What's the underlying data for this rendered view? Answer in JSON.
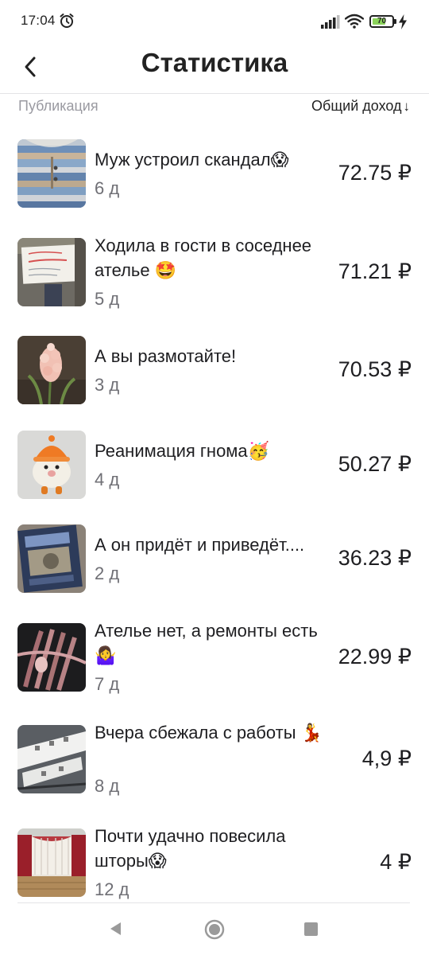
{
  "status_bar": {
    "time": "17:04",
    "battery_level": "70",
    "battery_fraction": 0.7,
    "icons": [
      "alarm-icon",
      "signal-icon",
      "wifi-icon",
      "battery-icon",
      "charging-bolt-icon"
    ]
  },
  "header": {
    "title": "Статистика",
    "back_icon": "chevron-left-icon"
  },
  "columns": {
    "publication": "Публикация",
    "income": "Общий доход",
    "sort_arrow": "↓"
  },
  "items": [
    {
      "title": "Муж устроил скандал😱",
      "age": "6 д",
      "income": "72.75 ₽"
    },
    {
      "title": "Ходила в гости в соседнее ателье 🤩",
      "age": "5 д",
      "income": "71.21 ₽"
    },
    {
      "title": "А вы размотайте!",
      "age": "3 д",
      "income": "70.53 ₽"
    },
    {
      "title": "Реанимация гнома🥳",
      "age": "4 д",
      "income": "50.27 ₽"
    },
    {
      "title": "А он придёт и приведёт....",
      "age": "2 д",
      "income": "36.23 ₽"
    },
    {
      "title": "Ателье нет, а ремонты есть🤷‍♀️",
      "age": "7 д",
      "income": "22.99 ₽"
    },
    {
      "title": "Вчера сбежала с работы 💃",
      "age": "8 д",
      "income": "4,9 ₽"
    },
    {
      "title": "Почти удачно повесила шторы😱",
      "age": "12 д",
      "income": "4 ₽"
    }
  ],
  "colors": {
    "accent_battery": "#8bd35a",
    "text_primary": "#1e1e21",
    "text_secondary": "#6f6f75",
    "text_muted": "#9a9aa1"
  },
  "nav_bar": {
    "icons": [
      "triangle-back-icon",
      "circle-home-icon",
      "square-recents-icon"
    ]
  }
}
